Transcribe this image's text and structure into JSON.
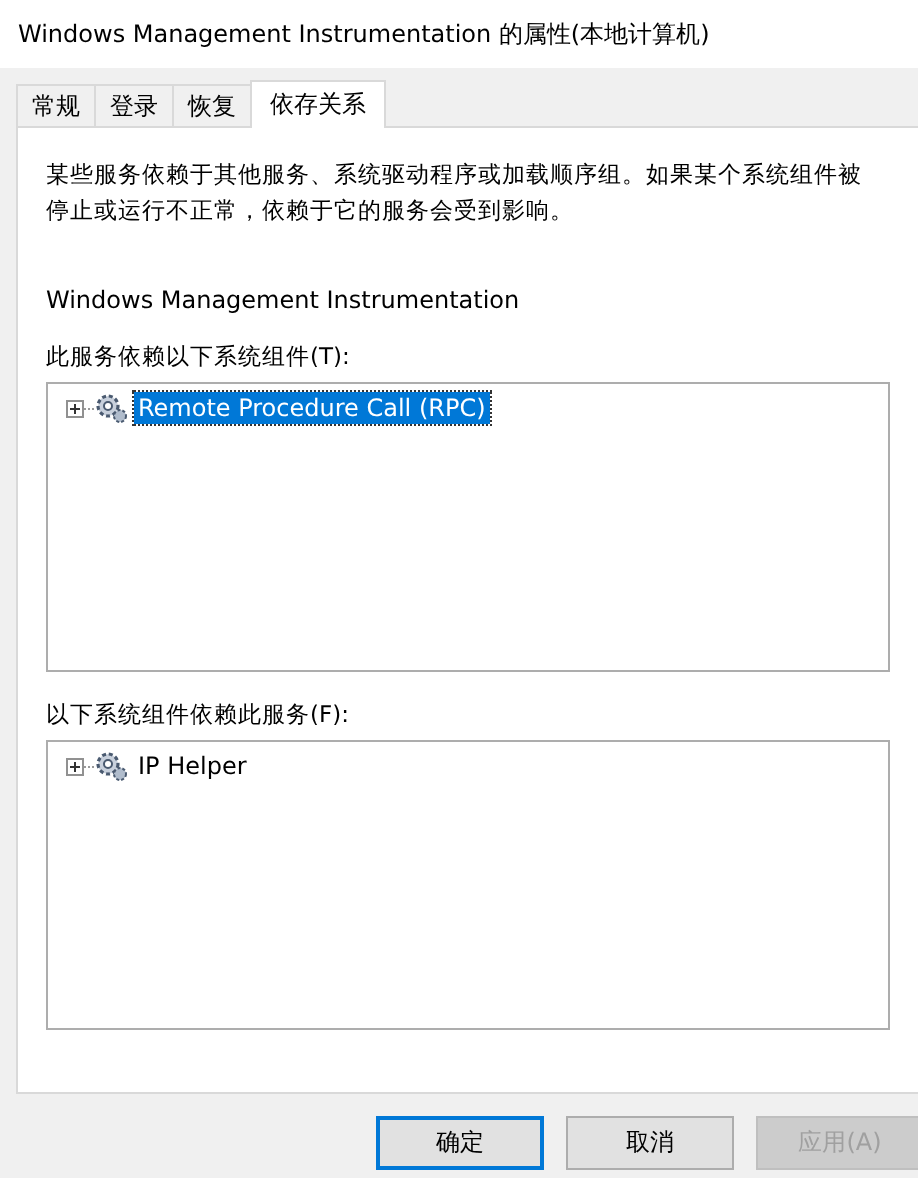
{
  "window": {
    "title": "Windows Management Instrumentation 的属性(本地计算机)"
  },
  "tabs": [
    {
      "label": "常规",
      "selected": false
    },
    {
      "label": "登录",
      "selected": false
    },
    {
      "label": "恢复",
      "selected": false
    },
    {
      "label": "依存关系",
      "selected": true
    }
  ],
  "description": "某些服务依赖于其他服务、系统驱动程序或加载顺序组。如果某个系统组件被停止或运行不正常，依赖于它的服务会受到影响。",
  "service_name": "Windows Management Instrumentation",
  "lists": [
    {
      "label": "此服务依赖以下系统组件(T):",
      "items": [
        {
          "label": "Remote Procedure Call (RPC)",
          "expanded": false,
          "selected": true
        }
      ]
    },
    {
      "label": "以下系统组件依赖此服务(F):",
      "items": [
        {
          "label": "IP Helper",
          "expanded": false,
          "selected": false
        }
      ]
    }
  ],
  "buttons": [
    {
      "label": "确定",
      "kind": "default",
      "disabled": false
    },
    {
      "label": "取消",
      "kind": "normal",
      "disabled": false
    },
    {
      "label": "应用(A)",
      "kind": "normal",
      "disabled": true
    }
  ]
}
